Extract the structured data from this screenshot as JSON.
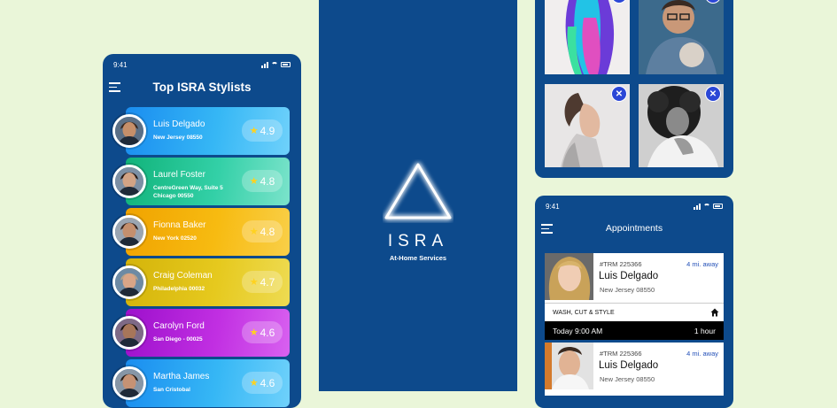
{
  "colors": {
    "background": "#eaf6d9",
    "phone": "#0d4a8c",
    "accent": "#2b47d6",
    "star": "#ffd21f"
  },
  "stylists_screen": {
    "time": "9:41",
    "title": "Top ISRA Stylists",
    "stylists": [
      {
        "name": "Luis Delgado",
        "address": "New Jersey 08550",
        "rating": "4.9",
        "gradient": "linear-gradient(100deg,#1a8df0,#36b7f5 55%,#6fd1fb)"
      },
      {
        "name": "Laurel Foster",
        "address": "CentreGreen Way, Suite 5 Chicago 00550",
        "rating": "4.8",
        "gradient": "linear-gradient(100deg,#11b37a,#33d0a7 55%,#7be3cb)"
      },
      {
        "name": "Fionna Baker",
        "address": "New York 02520",
        "rating": "4.8",
        "gradient": "linear-gradient(100deg,#f0a300,#f7bb11 55%,#f9cf48)"
      },
      {
        "name": "Craig Coleman",
        "address": "Philadelphia 00032",
        "rating": "4.7",
        "gradient": "linear-gradient(100deg,#d4b40a,#e6c91e 55%,#eedb52)"
      },
      {
        "name": "Carolyn Ford",
        "address": "San Diego - 00025",
        "rating": "4.6",
        "gradient": "linear-gradient(100deg,#9d10cc,#c12fe2 55%,#d861f0)"
      },
      {
        "name": "Martha James",
        "address": "San Cristobal",
        "rating": "4.6",
        "gradient": "linear-gradient(100deg,#1a8df0,#36b7f5 55%,#6fd1fb)"
      }
    ]
  },
  "splash_screen": {
    "brand": "ISRA",
    "tagline": "At-Home Services"
  },
  "appointments_screen": {
    "time": "9:41",
    "title": "Appointments",
    "appointments": [
      {
        "trm": "#TRM 225366",
        "distance": "4 mi. away",
        "name": "Luis Delgado",
        "address": "New Jersey 08550",
        "service": "WASH, CUT & STYLE",
        "when": "Today 9:00 AM",
        "duration": "1 hour"
      },
      {
        "trm": "#TRM 225366",
        "distance": "4 mi. away",
        "name": "Luis Delgado",
        "address": "New Jersey 08550"
      }
    ]
  },
  "icons": {
    "menu": "hamburger-menu-icon",
    "star": "star-icon",
    "remove": "close-icon",
    "home": "home-icon"
  }
}
